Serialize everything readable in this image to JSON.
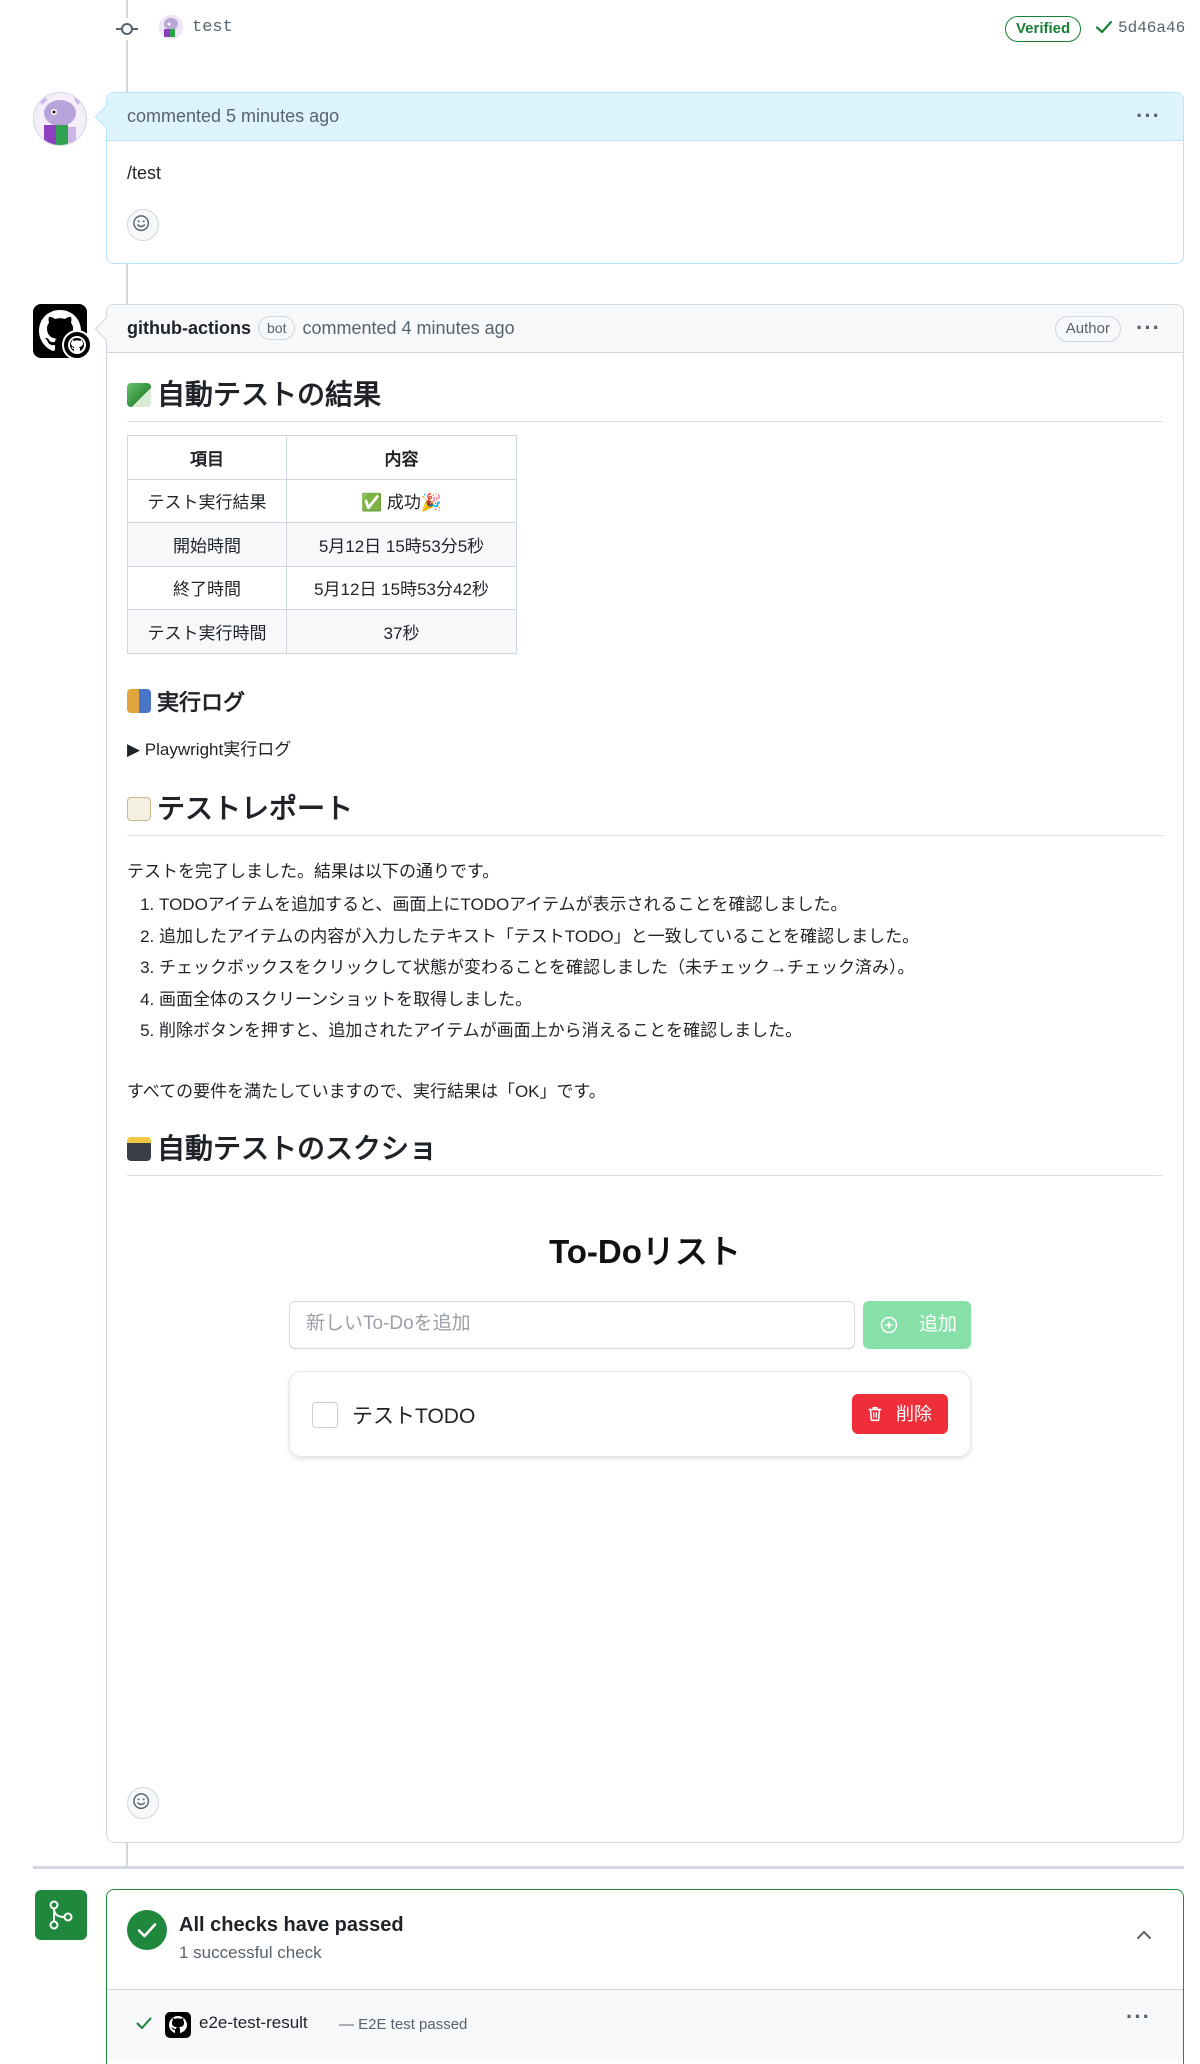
{
  "commit": {
    "message": "test",
    "verified_label": "Verified",
    "sha": "5d46a46"
  },
  "comment1": {
    "header": "commented 5 minutes ago",
    "body": "/test"
  },
  "comment2": {
    "author": "github-actions",
    "bot_label": "bot",
    "header_suffix": "commented 4 minutes ago",
    "author_badge": "Author",
    "h_results": "自動テストの結果",
    "table": {
      "headers": [
        "項目",
        "内容"
      ],
      "rows": [
        [
          "テスト実行結果",
          "✅ 成功🎉"
        ],
        [
          "開始時間",
          "5月12日 15時53分5秒"
        ],
        [
          "終了時間",
          "5月12日 15時53分42秒"
        ],
        [
          "テスト実行時間",
          "37秒"
        ]
      ]
    },
    "h_log": "実行ログ",
    "log_summary": "▶ Playwright実行ログ",
    "h_report": "テストレポート",
    "report_intro": "テストを完了しました。結果は以下の通りです。",
    "report_items": [
      "TODOアイテムを追加すると、画面上にTODOアイテムが表示されることを確認しました。",
      "追加したアイテムの内容が入力したテキスト「テストTODO」と一致していることを確認しました。",
      "チェックボックスをクリックして状態が変わることを確認しました（未チェック→チェック済み）。",
      "画面全体のスクリーンショットを取得しました。",
      "削除ボタンを押すと、追加されたアイテムが画面上から消えることを確認しました。"
    ],
    "report_outro": "すべての要件を満たしていますので、実行結果は「OK」です。",
    "h_screenshot": "自動テストのスクショ",
    "screenshot": {
      "title": "To-Doリスト",
      "input_placeholder": "新しいTo-Doを追加",
      "add_label": "追加",
      "todo_text": "テストTODO",
      "delete_label": "削除"
    }
  },
  "checks": {
    "title": "All checks have passed",
    "subtitle": "1 successful check",
    "rows": [
      {
        "name": "e2e-test-result",
        "desc": "— E2E test passed"
      }
    ]
  },
  "colors": {
    "success": "#1f883d",
    "highlight_header": "#ddf4ff",
    "delete": "#ef2e3a"
  }
}
